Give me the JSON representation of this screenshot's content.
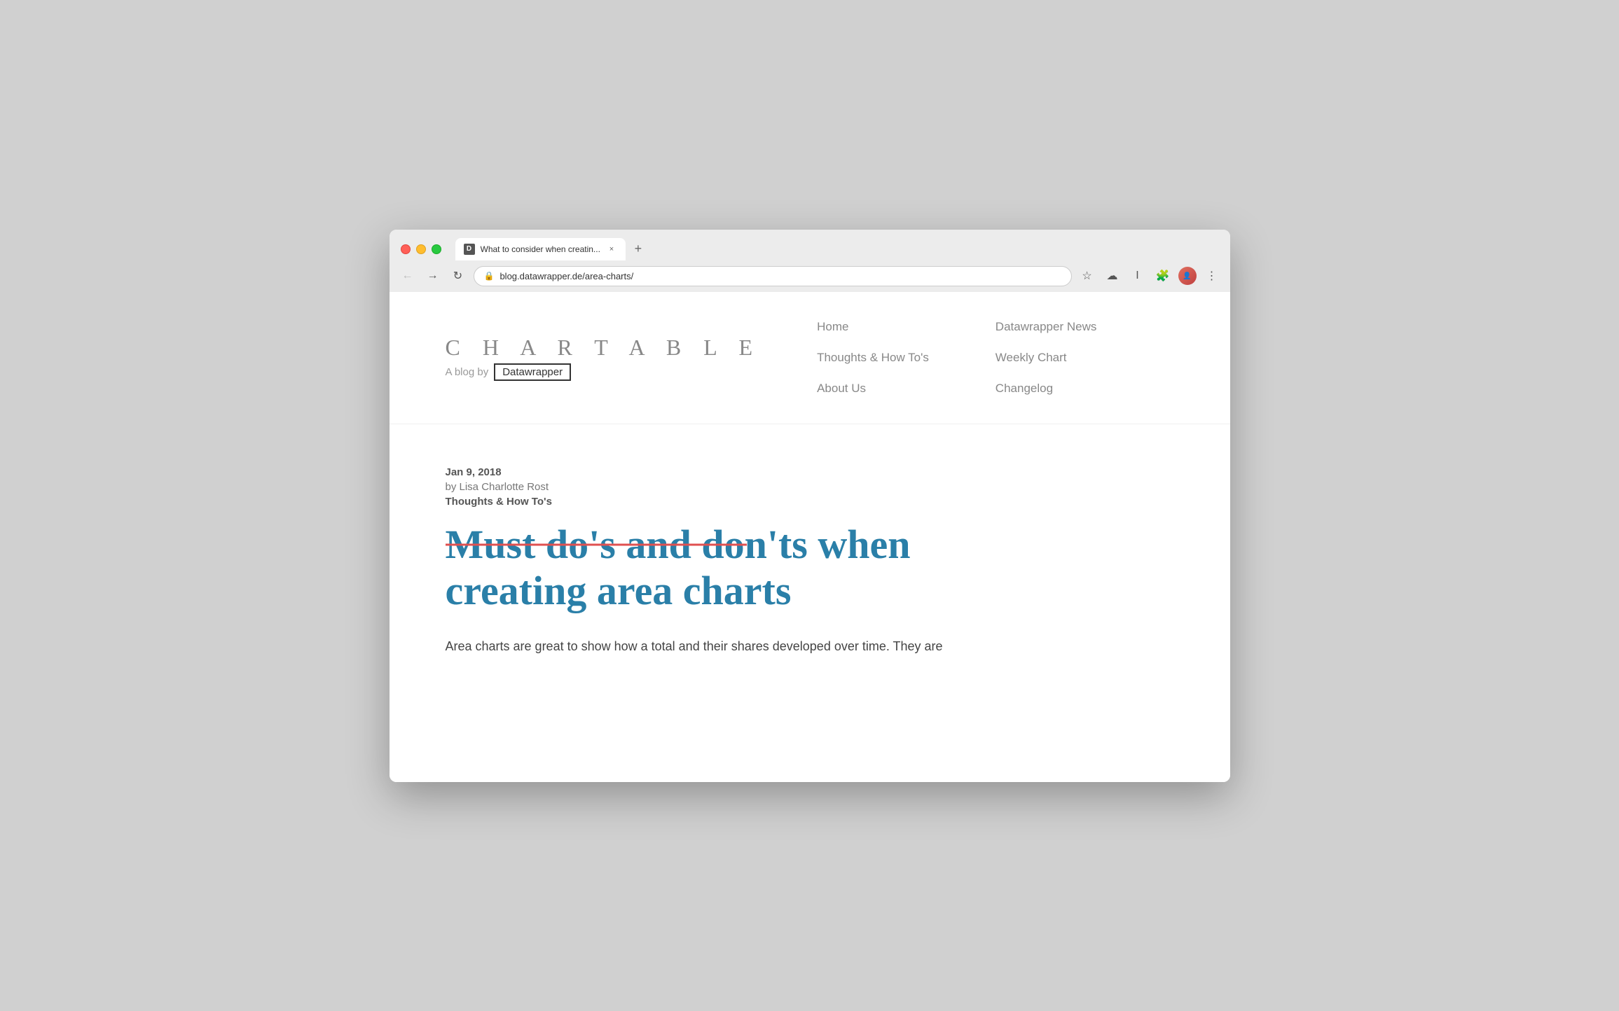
{
  "browser": {
    "tab": {
      "favicon_letter": "D",
      "title": "What to consider when creatin...",
      "close_label": "×",
      "new_tab_label": "+"
    },
    "nav": {
      "back_label": "←",
      "forward_label": "→",
      "refresh_label": "↻",
      "url": "blog.datawrapper.de/area-charts/",
      "lock_symbol": "🔒"
    },
    "toolbar_icons": {
      "star": "☆",
      "cloud": "☁",
      "cursor": "I",
      "puzzle": "🧩",
      "menu": "⋮"
    }
  },
  "site": {
    "logo": {
      "title": "C H A R T A B L E",
      "subtitle_prefix": "A blog by",
      "brand": "Datawrapper"
    },
    "nav": {
      "col1": [
        {
          "label": "Home"
        },
        {
          "label": "Thoughts & How To's"
        },
        {
          "label": "About Us"
        }
      ],
      "col2": [
        {
          "label": "Datawrapper News"
        },
        {
          "label": "Weekly Chart"
        },
        {
          "label": "Changelog"
        }
      ]
    }
  },
  "article": {
    "date": "Jan 9, 2018",
    "author": "by Lisa Charlotte Rost",
    "category": "Thoughts & How To's",
    "title_line1": "Must do's and don'ts when",
    "title_line2": "creating area charts",
    "body_start": "Area charts are great to show how a total and their shares developed over time. They are"
  }
}
